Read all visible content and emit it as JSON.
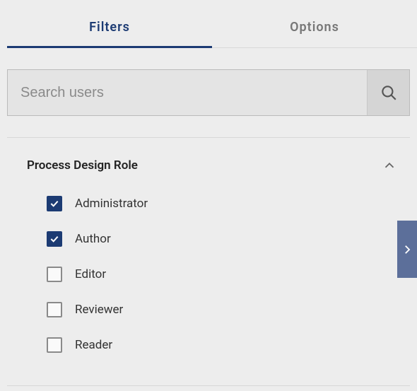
{
  "colors": {
    "accent": "#1c3b73",
    "side": "#5c6f9a"
  },
  "tabs": [
    {
      "label": "Filters",
      "active": true
    },
    {
      "label": "Options",
      "active": false
    }
  ],
  "search": {
    "placeholder": "Search users",
    "value": ""
  },
  "panel": {
    "title": "Process Design Role",
    "expanded": true,
    "options": [
      {
        "label": "Administrator",
        "checked": true
      },
      {
        "label": "Author",
        "checked": true
      },
      {
        "label": "Editor",
        "checked": false
      },
      {
        "label": "Reviewer",
        "checked": false
      },
      {
        "label": "Reader",
        "checked": false
      }
    ]
  }
}
